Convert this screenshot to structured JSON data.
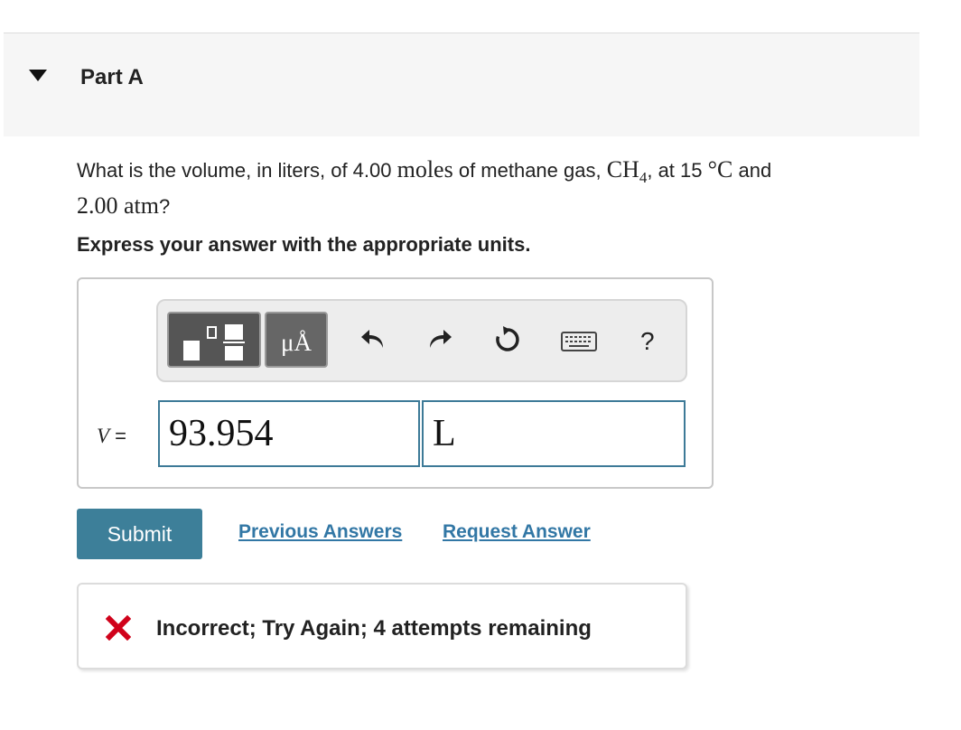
{
  "part": {
    "title": "Part A",
    "toggle_icon": "triangle-down-icon"
  },
  "question": {
    "text_1": "What is the volume, in liters, of 4.00 ",
    "math_moles": "moles",
    "text_2": " of methane gas, ",
    "formula_main": "CH",
    "formula_sub": "4",
    "text_3": ", at 15 ",
    "degree": "°C",
    "text_4": " and",
    "pressure": "2.00 atm",
    "text_5": "?"
  },
  "instruction": "Express your answer with the appropriate units.",
  "toolbar": {
    "units_label": "μÅ",
    "help_label": "?",
    "icons": [
      "templates-icon",
      "units-icon",
      "undo-icon",
      "redo-icon",
      "reset-icon",
      "keyboard-icon",
      "help-icon"
    ]
  },
  "answer": {
    "variable": "V",
    "equals": " = ",
    "value": "93.954",
    "unit": "L"
  },
  "actions": {
    "submit_label": "Submit",
    "previous_answers_label": "Previous Answers",
    "request_answer_label": "Request Answer"
  },
  "feedback": {
    "message": "Incorrect; Try Again; 4 attempts remaining",
    "icon": "x-icon",
    "icon_color": "#d0021b"
  },
  "colors": {
    "accent": "#3d7f99",
    "link": "#3277a5",
    "input_border": "#3d7a97"
  }
}
